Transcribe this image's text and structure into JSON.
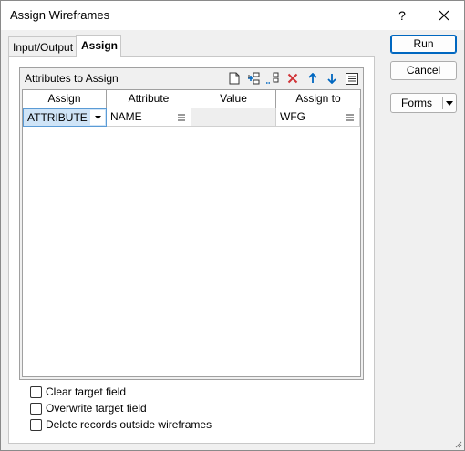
{
  "window": {
    "title": "Assign Wireframes",
    "help": "?",
    "close": "✕"
  },
  "tabs": [
    {
      "label": "Input/Output",
      "selected": false
    },
    {
      "label": "Assign",
      "selected": true
    }
  ],
  "group": {
    "title": "Attributes to Assign",
    "toolbar_icons": [
      "new-icon",
      "insert-row-icon",
      "append-row-icon",
      "delete-icon",
      "move-up-icon",
      "move-down-icon",
      "list-icon"
    ]
  },
  "grid": {
    "columns": [
      "Assign",
      "Attribute",
      "Value",
      "Assign to"
    ],
    "rows": [
      {
        "assign": "ATTRIBUTE",
        "attribute": "NAME",
        "value": "",
        "assign_to": "WFG"
      }
    ]
  },
  "checkboxes": [
    {
      "label": "Clear target field",
      "checked": false
    },
    {
      "label": "Overwrite target field",
      "checked": false
    },
    {
      "label": "Delete records outside wireframes",
      "checked": false
    }
  ],
  "buttons": {
    "run": "Run",
    "cancel": "Cancel",
    "forms": "Forms"
  },
  "colors": {
    "accent": "#0067c0",
    "selection": "#cfe4f7",
    "delete_red": "#d13438",
    "arrow_blue": "#0067c0"
  }
}
